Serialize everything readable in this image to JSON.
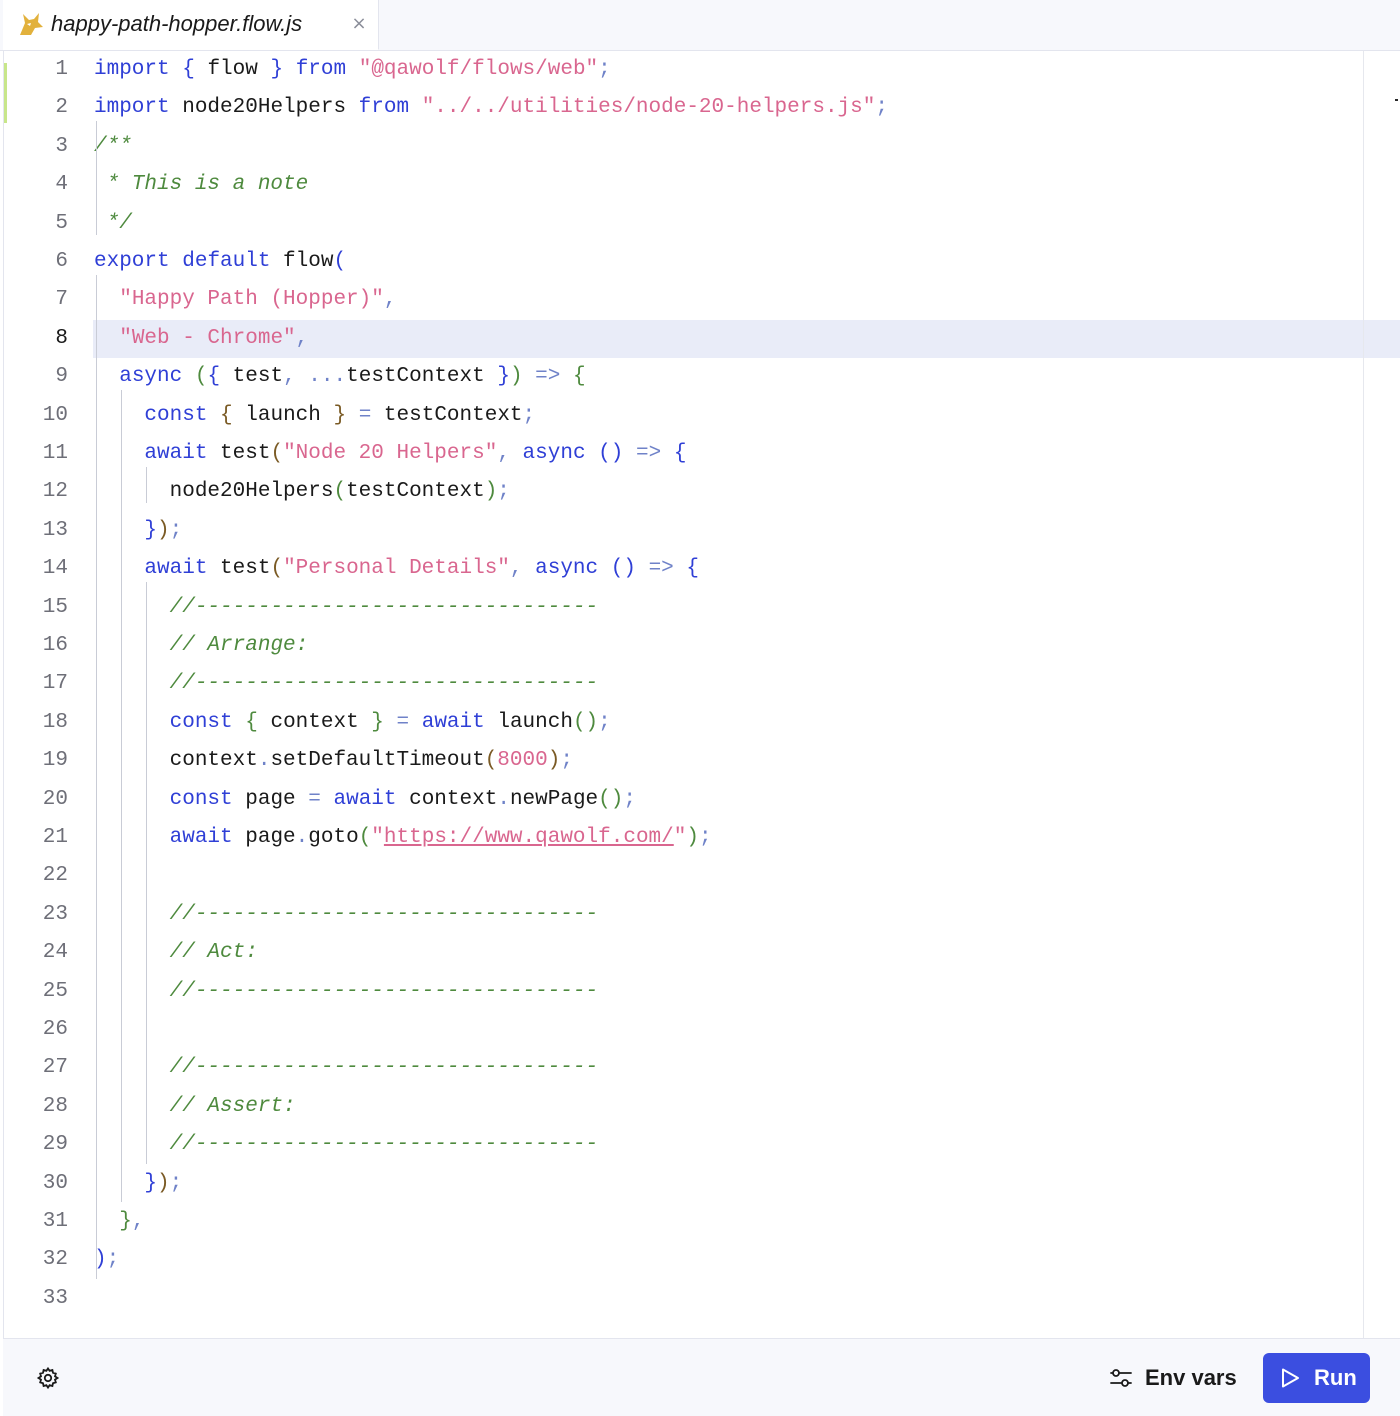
{
  "tab": {
    "title": "happy-path-hopper.flow.js",
    "close_glyph": "×",
    "icon": "wolf-logo-icon"
  },
  "editor": {
    "current_line": 8,
    "lines": [
      {
        "num": "1",
        "tokens": [
          [
            "kw",
            "import"
          ],
          [
            "id",
            " "
          ],
          [
            "brace",
            "{"
          ],
          [
            "id",
            " flow "
          ],
          [
            "brace",
            "}"
          ],
          [
            "id",
            " "
          ],
          [
            "kw",
            "from"
          ],
          [
            "id",
            " "
          ],
          [
            "str",
            "\"@qawolf/flows/web\""
          ],
          [
            "punc",
            ";"
          ]
        ]
      },
      {
        "num": "2",
        "tokens": [
          [
            "kw",
            "import"
          ],
          [
            "id",
            " node20Helpers "
          ],
          [
            "kw",
            "from"
          ],
          [
            "id",
            " "
          ],
          [
            "str",
            "\"../../utilities/node-20-helpers.js\""
          ],
          [
            "punc",
            ";"
          ]
        ]
      },
      {
        "num": "3",
        "tokens": [
          [
            "com",
            "/**"
          ]
        ]
      },
      {
        "num": "4",
        "tokens": [
          [
            "com",
            " * This is a note"
          ]
        ]
      },
      {
        "num": "5",
        "tokens": [
          [
            "com",
            " */"
          ]
        ]
      },
      {
        "num": "6",
        "tokens": [
          [
            "kw",
            "export"
          ],
          [
            "id",
            " "
          ],
          [
            "kw",
            "default"
          ],
          [
            "id",
            " flow"
          ],
          [
            "brace",
            "("
          ]
        ]
      },
      {
        "num": "7",
        "tokens": [
          [
            "id",
            "  "
          ],
          [
            "str",
            "\"Happy Path (Hopper)\""
          ],
          [
            "punc",
            ","
          ]
        ]
      },
      {
        "num": "8",
        "tokens": [
          [
            "id",
            "  "
          ],
          [
            "str",
            "\"Web - Chrome\""
          ],
          [
            "punc",
            ","
          ]
        ]
      },
      {
        "num": "9",
        "tokens": [
          [
            "id",
            "  "
          ],
          [
            "kw",
            "async"
          ],
          [
            "id",
            " "
          ],
          [
            "brace2",
            "("
          ],
          [
            "brace",
            "{"
          ],
          [
            "id",
            " test"
          ],
          [
            "punc",
            ","
          ],
          [
            "id",
            " "
          ],
          [
            "punc",
            "..."
          ],
          [
            "id",
            "testContext "
          ],
          [
            "brace",
            "}"
          ],
          [
            "brace2",
            ")"
          ],
          [
            "id",
            " "
          ],
          [
            "punc",
            "=>"
          ],
          [
            "id",
            " "
          ],
          [
            "brace2",
            "{"
          ]
        ]
      },
      {
        "num": "10",
        "tokens": [
          [
            "id",
            "    "
          ],
          [
            "kw",
            "const"
          ],
          [
            "id",
            " "
          ],
          [
            "paren",
            "{"
          ],
          [
            "id",
            " launch "
          ],
          [
            "paren",
            "}"
          ],
          [
            "id",
            " "
          ],
          [
            "punc",
            "="
          ],
          [
            "id",
            " testContext"
          ],
          [
            "punc",
            ";"
          ]
        ]
      },
      {
        "num": "11",
        "tokens": [
          [
            "id",
            "    "
          ],
          [
            "kw",
            "await"
          ],
          [
            "id",
            " test"
          ],
          [
            "paren",
            "("
          ],
          [
            "str",
            "\"Node 20 Helpers\""
          ],
          [
            "punc",
            ","
          ],
          [
            "id",
            " "
          ],
          [
            "kw",
            "async"
          ],
          [
            "id",
            " "
          ],
          [
            "kw",
            "()"
          ],
          [
            "id",
            " "
          ],
          [
            "punc",
            "=>"
          ],
          [
            "id",
            " "
          ],
          [
            "brace",
            "{"
          ]
        ]
      },
      {
        "num": "12",
        "tokens": [
          [
            "id",
            "      node20Helpers"
          ],
          [
            "brace2",
            "("
          ],
          [
            "id",
            "testContext"
          ],
          [
            "brace2",
            ")"
          ],
          [
            "punc",
            ";"
          ]
        ]
      },
      {
        "num": "13",
        "tokens": [
          [
            "id",
            "    "
          ],
          [
            "brace",
            "}"
          ],
          [
            "paren",
            ")"
          ],
          [
            "punc",
            ";"
          ]
        ]
      },
      {
        "num": "14",
        "tokens": [
          [
            "id",
            "    "
          ],
          [
            "kw",
            "await"
          ],
          [
            "id",
            " test"
          ],
          [
            "paren",
            "("
          ],
          [
            "str",
            "\"Personal Details\""
          ],
          [
            "punc",
            ","
          ],
          [
            "id",
            " "
          ],
          [
            "kw",
            "async"
          ],
          [
            "id",
            " "
          ],
          [
            "kw",
            "()"
          ],
          [
            "id",
            " "
          ],
          [
            "punc",
            "=>"
          ],
          [
            "id",
            " "
          ],
          [
            "brace",
            "{"
          ]
        ]
      },
      {
        "num": "15",
        "tokens": [
          [
            "id",
            "      "
          ],
          [
            "com",
            "//--------------------------------"
          ]
        ]
      },
      {
        "num": "16",
        "tokens": [
          [
            "id",
            "      "
          ],
          [
            "com",
            "// Arrange:"
          ]
        ]
      },
      {
        "num": "17",
        "tokens": [
          [
            "id",
            "      "
          ],
          [
            "com",
            "//--------------------------------"
          ]
        ]
      },
      {
        "num": "18",
        "tokens": [
          [
            "id",
            "      "
          ],
          [
            "kw",
            "const"
          ],
          [
            "id",
            " "
          ],
          [
            "brace2",
            "{"
          ],
          [
            "id",
            " context "
          ],
          [
            "brace2",
            "}"
          ],
          [
            "id",
            " "
          ],
          [
            "punc",
            "="
          ],
          [
            "id",
            " "
          ],
          [
            "kw",
            "await"
          ],
          [
            "id",
            " launch"
          ],
          [
            "brace2",
            "()"
          ],
          [
            "punc",
            ";"
          ]
        ]
      },
      {
        "num": "19",
        "tokens": [
          [
            "id",
            "      context"
          ],
          [
            "punc",
            "."
          ],
          [
            "id",
            "setDefaultTimeout"
          ],
          [
            "paren",
            "("
          ],
          [
            "num",
            "8000"
          ],
          [
            "paren",
            ")"
          ],
          [
            "punc",
            ";"
          ]
        ]
      },
      {
        "num": "20",
        "tokens": [
          [
            "id",
            "      "
          ],
          [
            "kw",
            "const"
          ],
          [
            "id",
            " page "
          ],
          [
            "punc",
            "="
          ],
          [
            "id",
            " "
          ],
          [
            "kw",
            "await"
          ],
          [
            "id",
            " context"
          ],
          [
            "punc",
            "."
          ],
          [
            "id",
            "newPage"
          ],
          [
            "brace2",
            "()"
          ],
          [
            "punc",
            ";"
          ]
        ]
      },
      {
        "num": "21",
        "tokens": [
          [
            "id",
            "      "
          ],
          [
            "kw",
            "await"
          ],
          [
            "id",
            " page"
          ],
          [
            "punc",
            "."
          ],
          [
            "id",
            "goto"
          ],
          [
            "brace2",
            "("
          ],
          [
            "str",
            "\""
          ],
          [
            "url",
            "https://www.qawolf.com/"
          ],
          [
            "str",
            "\""
          ],
          [
            "brace2",
            ")"
          ],
          [
            "punc",
            ";"
          ]
        ]
      },
      {
        "num": "22",
        "tokens": []
      },
      {
        "num": "23",
        "tokens": [
          [
            "id",
            "      "
          ],
          [
            "com",
            "//--------------------------------"
          ]
        ]
      },
      {
        "num": "24",
        "tokens": [
          [
            "id",
            "      "
          ],
          [
            "com",
            "// Act:"
          ]
        ]
      },
      {
        "num": "25",
        "tokens": [
          [
            "id",
            "      "
          ],
          [
            "com",
            "//--------------------------------"
          ]
        ]
      },
      {
        "num": "26",
        "tokens": []
      },
      {
        "num": "27",
        "tokens": [
          [
            "id",
            "      "
          ],
          [
            "com",
            "//--------------------------------"
          ]
        ]
      },
      {
        "num": "28",
        "tokens": [
          [
            "id",
            "      "
          ],
          [
            "com",
            "// Assert:"
          ]
        ]
      },
      {
        "num": "29",
        "tokens": [
          [
            "id",
            "      "
          ],
          [
            "com",
            "//--------------------------------"
          ]
        ]
      },
      {
        "num": "30",
        "tokens": [
          [
            "id",
            "    "
          ],
          [
            "brace",
            "}"
          ],
          [
            "paren",
            ")"
          ],
          [
            "punc",
            ";"
          ]
        ]
      },
      {
        "num": "31",
        "tokens": [
          [
            "id",
            "  "
          ],
          [
            "brace2",
            "}"
          ],
          [
            "punc",
            ","
          ]
        ]
      },
      {
        "num": "32",
        "tokens": [
          [
            "brace",
            ")"
          ],
          [
            "punc",
            ";"
          ]
        ]
      },
      {
        "num": "33",
        "tokens": []
      }
    ]
  },
  "footer": {
    "settings_icon": "gear-icon",
    "env_label": "Env vars",
    "env_icon": "sliders-icon",
    "run_label": "Run",
    "run_icon": "play-icon",
    "run_color": "#3b4ee0"
  }
}
